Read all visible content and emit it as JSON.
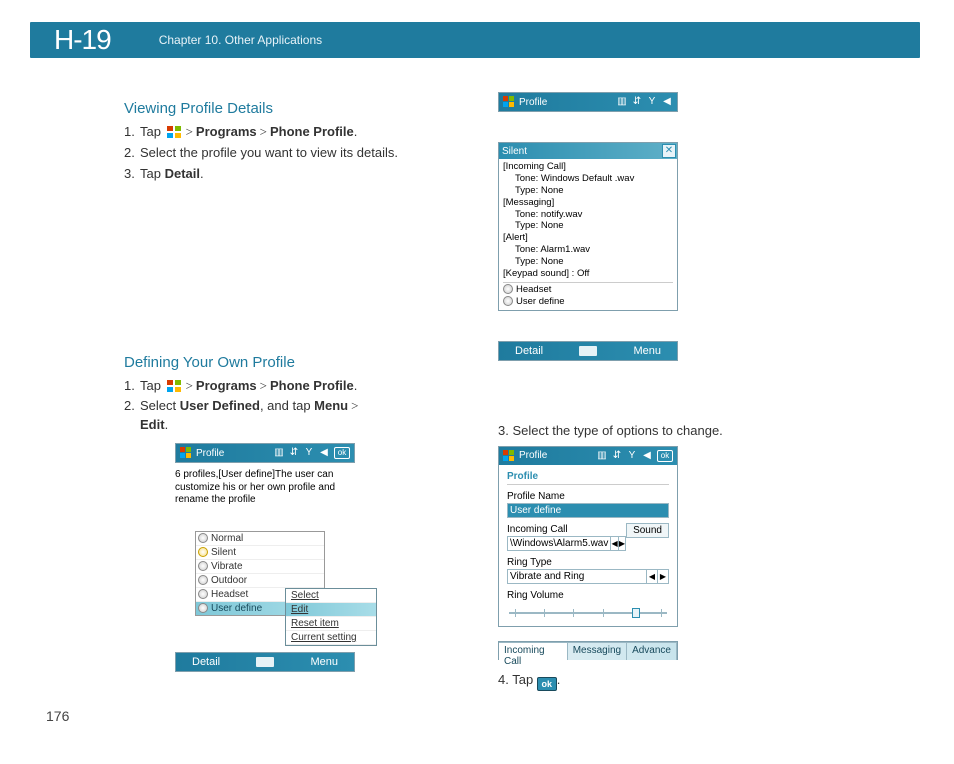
{
  "header": {
    "brand": "H-19",
    "chapter": "Chapter 10. Other Applications"
  },
  "page_number": "176",
  "sectionA": {
    "heading": "Viewing Profile Details",
    "step1_pre": "Tap ",
    "step1_programs": "Programs",
    "step1_phoneprofile": "Phone Profile",
    "step2": "Select the profile you want to view its details.",
    "step3_pre": "Tap ",
    "step3_detail": "Detail"
  },
  "silent_shot": {
    "title": "Profile",
    "subhead": "Silent",
    "lines": [
      "[Incoming Call]",
      "Tone: Windows Default .wav",
      "Type: None",
      "[Messaging]",
      "Tone: notify.wav",
      "Type: None",
      "[Alert]",
      "Tone: Alarm1.wav",
      "Type: None",
      "[Keypad sound] : Off"
    ],
    "hidden1": "Headset",
    "hidden2": "User define",
    "bottom_left": "Detail",
    "bottom_right": "Menu"
  },
  "sectionB": {
    "heading": "Defining Your Own Profile",
    "step1_pre": "Tap ",
    "step1_programs": "Programs",
    "step1_phoneprofile": "Phone Profile",
    "step2_pre": "Select ",
    "step2_userdef": "User Defined",
    "step2_mid": ", and tap ",
    "step2_menu": "Menu",
    "step2_edit": "Edit"
  },
  "profile_list_shot": {
    "title": "Profile",
    "ok": "ok",
    "desc": "6 profiles,[User define]The user can customize his or her own profile and rename the profile",
    "items": [
      "Normal",
      "Silent",
      "Vibrate",
      "Outdoor",
      "Headset",
      "User define"
    ],
    "menu_items": [
      "Select",
      "Edit",
      "Reset item",
      "Current setting"
    ],
    "bottom_left": "Detail",
    "bottom_right": "Menu"
  },
  "sectionC": {
    "step3": "Select the type of options to change.",
    "step4_pre": "Tap ",
    "step4_ok": "ok"
  },
  "edit_shot": {
    "title": "Profile",
    "ok": "ok",
    "head": "Profile",
    "label_name": "Profile Name",
    "name_value": "User define",
    "label_incoming": "Incoming Call",
    "sound_btn": "Sound",
    "incoming_value": "\\Windows\\Alarm5.wav",
    "label_ringtype": "Ring Type",
    "ringtype_value": "Vibrate and Ring",
    "label_ringvol": "Ring Volume",
    "tabs": [
      "Incoming Call",
      "Messaging",
      "Advance"
    ]
  }
}
